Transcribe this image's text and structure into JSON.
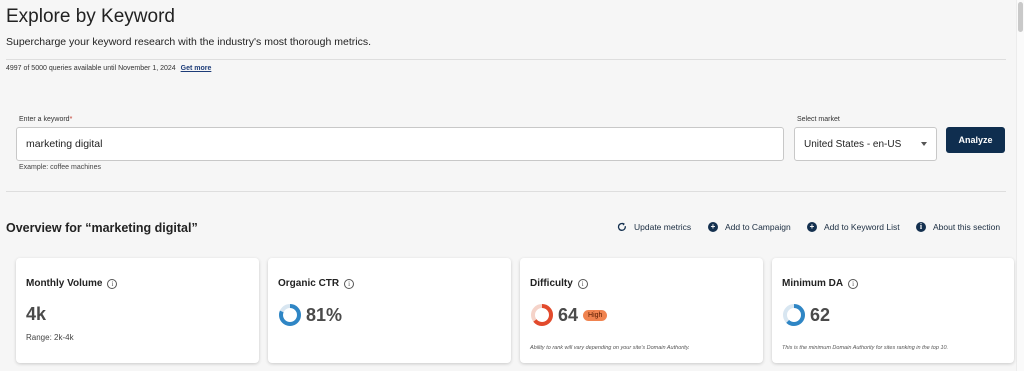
{
  "header": {
    "title": "Explore by Keyword",
    "subtitle": "Supercharge your keyword research with the industry's most thorough metrics.",
    "quota_text": "4997 of 5000 queries available until November 1, 2024",
    "get_more": "Get more"
  },
  "search": {
    "keyword_label": "Enter a keyword",
    "required_mark": "*",
    "keyword_value": "marketing digital",
    "example": "Example: coffee machines",
    "market_label": "Select market",
    "market_value": "United States - en-US",
    "analyze_label": "Analyze"
  },
  "overview": {
    "title": "Overview for “marketing digital”",
    "actions": [
      {
        "label": "Update metrics",
        "icon": "refresh-icon"
      },
      {
        "label": "Add to Campaign",
        "icon": "plus-circle-icon"
      },
      {
        "label": "Add to Keyword List",
        "icon": "plus-circle-icon"
      },
      {
        "label": "About this section",
        "icon": "info-circle-icon"
      }
    ]
  },
  "cards": {
    "volume": {
      "title": "Monthly Volume",
      "value": "4k",
      "range": "Range: 2k-4k"
    },
    "ctr": {
      "title": "Organic CTR",
      "value": "81%",
      "gauge_fraction": 0.81,
      "gauge_color": "#2f86c5"
    },
    "difficulty": {
      "title": "Difficulty",
      "value": "64",
      "badge": "High",
      "gauge_fraction": 0.64,
      "gauge_color": "#e24a2c",
      "note": "Ability to rank will vary depending on your site's Domain Authority."
    },
    "da": {
      "title": "Minimum DA",
      "value": "62",
      "gauge_fraction": 0.62,
      "gauge_color": "#2f86c5",
      "note": "This is the minimum Domain Authority for sites ranking in the top 10."
    }
  },
  "colors": {
    "primary_button": "#0f2e4f",
    "badge_high": "#f0834f",
    "gauge_track": "#d8e6f1"
  }
}
